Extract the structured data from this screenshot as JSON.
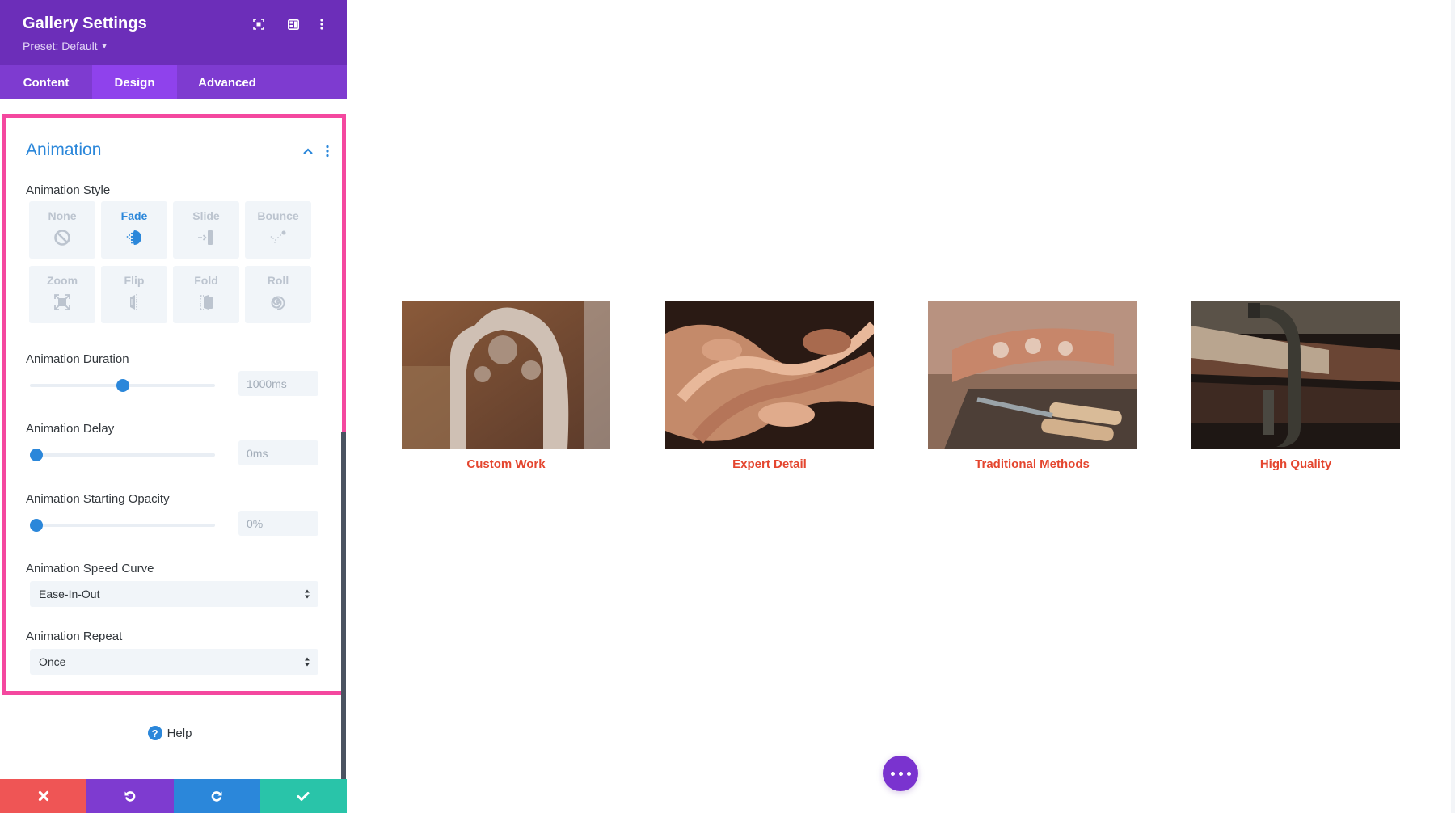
{
  "panel": {
    "title": "Gallery Settings",
    "preset_label": "Preset: Default",
    "header_icons": [
      "focus-mode-icon",
      "split-view-icon",
      "more-options-icon"
    ],
    "tabs": [
      {
        "label": "Content",
        "active": false
      },
      {
        "label": "Design",
        "active": true
      },
      {
        "label": "Advanced",
        "active": false
      }
    ],
    "accent_color": "#6c2eb9",
    "highlight_border_color": "#f4489f"
  },
  "animation": {
    "section_title": "Animation",
    "style_label": "Animation Style",
    "styles": [
      {
        "label": "None",
        "icon": "none-icon",
        "active": false
      },
      {
        "label": "Fade",
        "icon": "fade-icon",
        "active": true
      },
      {
        "label": "Slide",
        "icon": "slide-icon",
        "active": false
      },
      {
        "label": "Bounce",
        "icon": "bounce-icon",
        "active": false
      },
      {
        "label": "Zoom",
        "icon": "zoom-icon",
        "active": false
      },
      {
        "label": "Flip",
        "icon": "flip-icon",
        "active": false
      },
      {
        "label": "Fold",
        "icon": "fold-icon",
        "active": false
      },
      {
        "label": "Roll",
        "icon": "roll-icon",
        "active": false
      }
    ],
    "duration": {
      "label": "Animation Duration",
      "value": "1000ms",
      "slider_fraction": 0.5
    },
    "delay": {
      "label": "Animation Delay",
      "value": "0ms",
      "slider_fraction": 0.0
    },
    "opacity": {
      "label": "Animation Starting Opacity",
      "value": "0%",
      "slider_fraction": 0.0
    },
    "speed_curve": {
      "label": "Animation Speed Curve",
      "value": "Ease-In-Out"
    },
    "repeat": {
      "label": "Animation Repeat",
      "value": "Once"
    }
  },
  "help": {
    "label": "Help"
  },
  "footer": {
    "buttons": [
      {
        "name": "cancel",
        "icon": "close-icon",
        "color": "#ef5555"
      },
      {
        "name": "undo",
        "icon": "undo-icon",
        "color": "#7e3bd0"
      },
      {
        "name": "redo",
        "icon": "redo-icon",
        "color": "#2b87da"
      },
      {
        "name": "save",
        "icon": "check-icon",
        "color": "#29c4a9"
      }
    ]
  },
  "gallery": {
    "caption_color": "#e4462f",
    "items": [
      {
        "caption": "Custom Work"
      },
      {
        "caption": "Expert Detail"
      },
      {
        "caption": "Traditional Methods"
      },
      {
        "caption": "High Quality"
      }
    ]
  },
  "fab": {
    "icon": "more-horizontal-icon"
  }
}
